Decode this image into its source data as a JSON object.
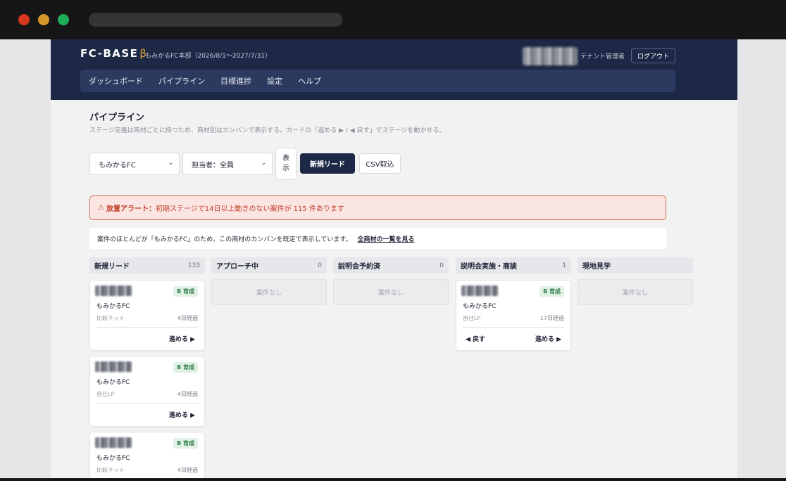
{
  "header": {
    "logo": "FC-BASE",
    "beta": "β",
    "org": "もみかるFC本部（2026/8/1～2027/7/31）",
    "role": "テナント管理者",
    "logout": "ログアウト"
  },
  "nav": [
    "ダッシュボード",
    "パイプライン",
    "目標進捗",
    "設定",
    "ヘルプ"
  ],
  "page": {
    "title": "パイプライン",
    "description": "ステージ定義は商材ごとに持つため、商材別はカンバンで表示する。カードの「進める ▶ / ◀ 戻す」でステージを動かせる。"
  },
  "toolbar": {
    "company_select": "もみかるFC",
    "owner_select": "担当者：全員",
    "view_button": "表示",
    "new_lead_button": "新規リード",
    "csv_button": "CSV取込"
  },
  "alert": {
    "icon": "⚠",
    "label": "放置アラート：",
    "text": "初期ステージで14日以上動きのない案件が 115 件あります"
  },
  "notice": {
    "text": "案件のほとんどが「もみかるFC」のため、この商材のカンバンを既定で表示しています。",
    "link": "全商材の一覧を見る"
  },
  "columns": [
    {
      "title": "新規リード",
      "count": "133"
    },
    {
      "title": "アプローチ中",
      "count": "0",
      "empty": "案件なし"
    },
    {
      "title": "説明会予約済",
      "count": "0",
      "empty": "案件なし"
    },
    {
      "title": "説明会実施・商談",
      "count": "1"
    },
    {
      "title": "現地見学",
      "empty": "案件なし"
    }
  ],
  "cards": [
    {
      "badge": "B 育成",
      "company": "もみかるFC",
      "source": "比較ネット",
      "elapsed": "4日経過",
      "advance": "進める ▶"
    },
    {
      "badge": "B 育成",
      "company": "もみかるFC",
      "source": "自社LP",
      "elapsed": "4日経過",
      "advance": "進める ▶"
    },
    {
      "badge": "B 育成",
      "company": "もみかるFC",
      "source": "比較ネット",
      "elapsed": "4日経過"
    },
    {
      "badge": "B 育成",
      "company": "もみかるFC",
      "source": "自社LP",
      "elapsed": "17日経過",
      "back": "◀ 戻す",
      "advance": "進める ▶"
    }
  ],
  "colors": {
    "header_bg": "#1c2846",
    "nav_bg": "#2c3a60",
    "beta_accent": "#e0a63a",
    "alert_text": "#c2412f",
    "badge_green": "#2f7d4a"
  }
}
